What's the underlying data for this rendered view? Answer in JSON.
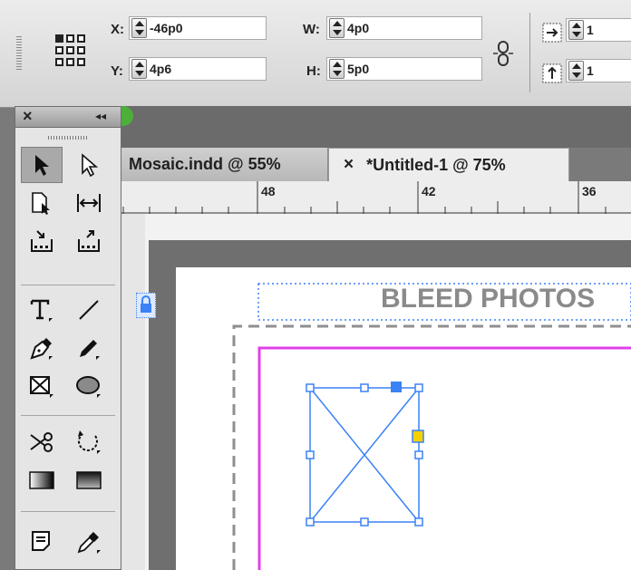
{
  "control_panel": {
    "x": {
      "label": "X:",
      "value": "-46p0"
    },
    "y": {
      "label": "Y:",
      "value": "4p6"
    },
    "w": {
      "label": "W:",
      "value": "4p0"
    },
    "h": {
      "label": "H:",
      "value": "5p0"
    },
    "scale_x_value": "1",
    "scale_y_value": "1"
  },
  "tools_panel": {
    "close_glyph": "×",
    "collapse_glyph": "◂◂",
    "tools": [
      "selection",
      "direct-selection",
      "page",
      "gap",
      "content-collector",
      "content-placer",
      "type",
      "line",
      "pen",
      "pencil",
      "rectangle-frame",
      "ellipse",
      "scissors",
      "free-transform",
      "gradient-swatch",
      "gradient-feather",
      "note",
      "eyedropper"
    ]
  },
  "tabs": [
    {
      "label": "Mosaic.indd @ 55%",
      "active": false
    },
    {
      "label": "*Untitled-1 @ 75%",
      "active": true
    }
  ],
  "tab_close_glyph": "×",
  "ruler": {
    "labels": [
      "48",
      "42",
      "36"
    ]
  },
  "document": {
    "bleed_text": "BLEED PHOTOS"
  },
  "colors": {
    "selection_blue": "#3b82f6",
    "margin_magenta": "#e040e8",
    "handle_yellow": "#f5d000",
    "bleed_text": "#8a8a8a"
  }
}
